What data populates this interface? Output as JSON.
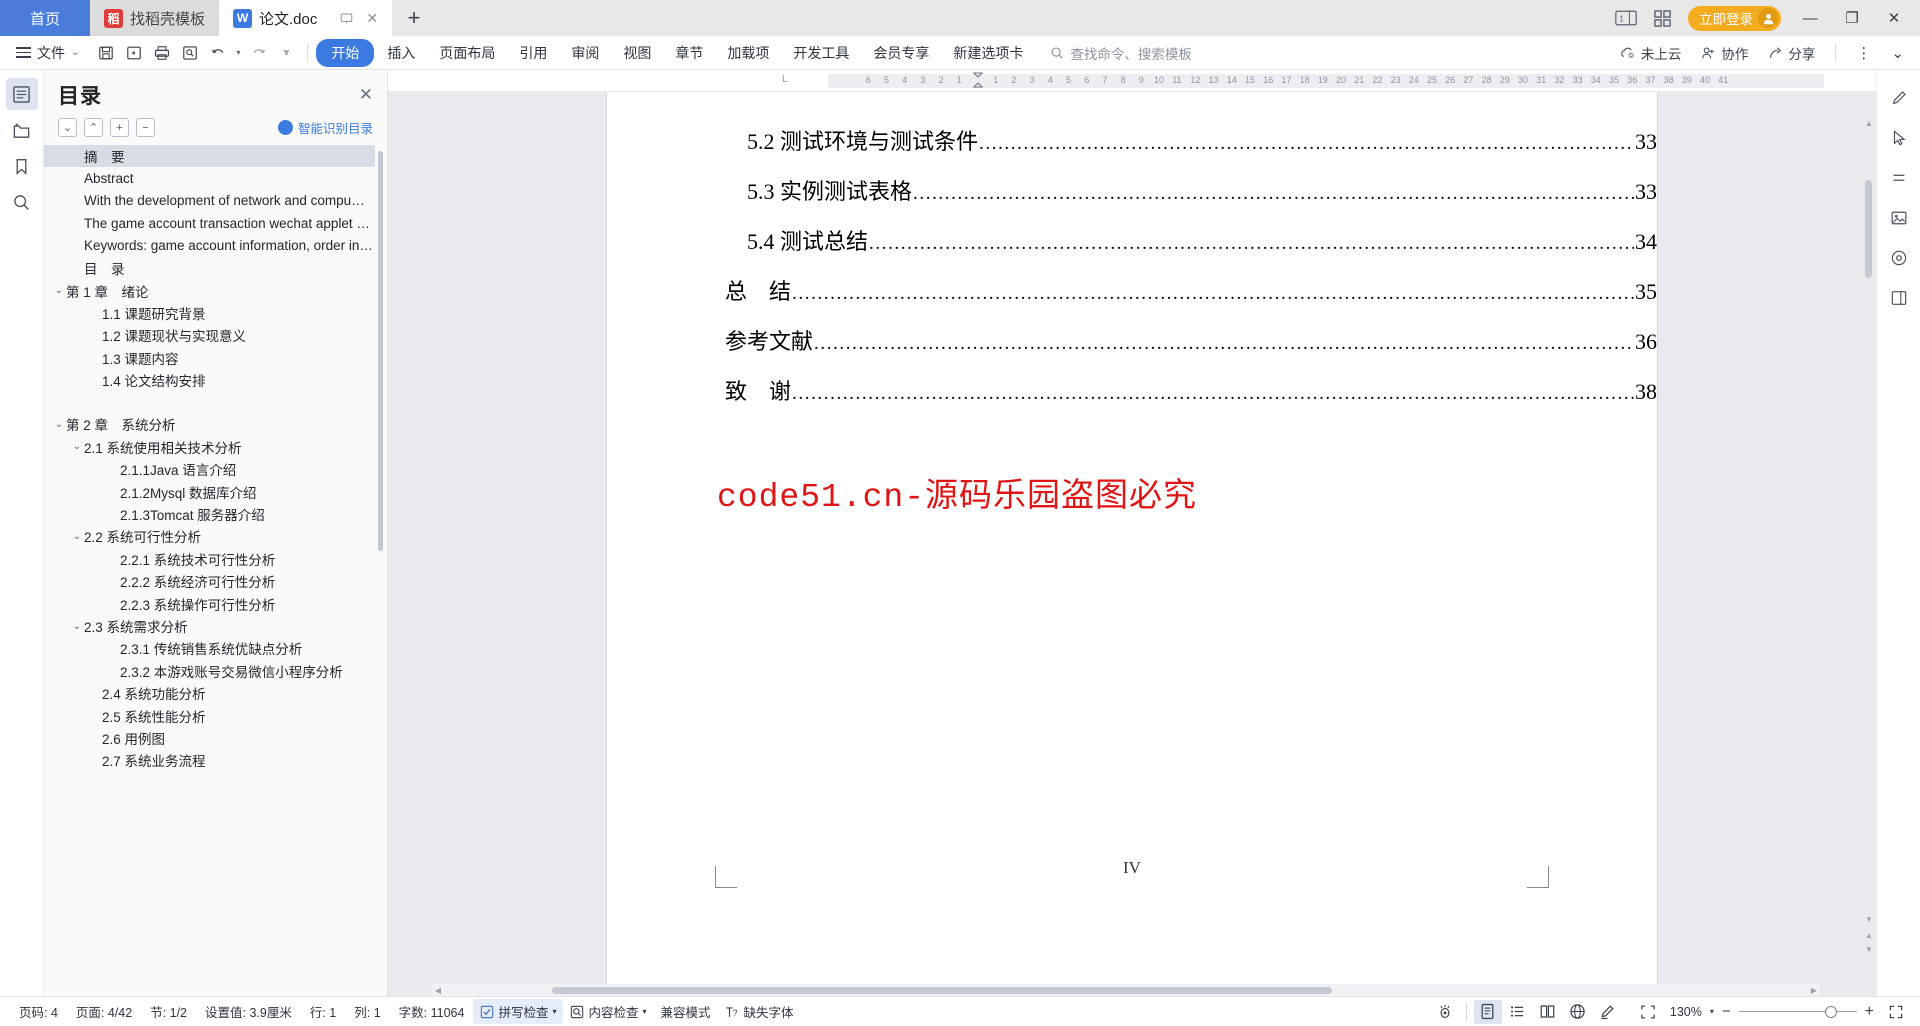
{
  "window": {
    "tabs": [
      {
        "label": "首页",
        "type": "home",
        "icon": null
      },
      {
        "label": "找稻壳模板",
        "type": "mid",
        "icon": "docer-icon"
      },
      {
        "label": "论文.doc",
        "type": "active",
        "icon": "wps-writer-icon"
      }
    ],
    "new_tab_label": "+",
    "controls": {
      "dual_screen_label": "1",
      "grid_label": "grid-icon",
      "login_label": "立即登录",
      "minimize": "—",
      "restore": "❐",
      "close": "✕"
    }
  },
  "ribbon": {
    "file_label": "文件",
    "quick_access": [
      "save-icon",
      "save-as-icon",
      "print-icon",
      "print-preview-icon",
      "undo-icon",
      "redo-icon",
      "customize-icon"
    ],
    "tabs": [
      {
        "label": "开始",
        "active": true
      },
      {
        "label": "插入",
        "active": false
      },
      {
        "label": "页面布局",
        "active": false
      },
      {
        "label": "引用",
        "active": false
      },
      {
        "label": "审阅",
        "active": false
      },
      {
        "label": "视图",
        "active": false
      },
      {
        "label": "章节",
        "active": false
      },
      {
        "label": "加载项",
        "active": false
      },
      {
        "label": "开发工具",
        "active": false
      },
      {
        "label": "会员专享",
        "active": false
      },
      {
        "label": "新建选项卡",
        "active": false
      }
    ],
    "search_placeholder": "查找命令、搜索模板",
    "right_items": [
      {
        "label": "未上云",
        "icon": "cloud-off-icon"
      },
      {
        "label": "协作",
        "icon": "collaborate-icon"
      },
      {
        "label": "分享",
        "icon": "share-icon"
      }
    ],
    "more_label": "⋮",
    "collapse_label": "⌄"
  },
  "left_rail": [
    {
      "name": "outline-icon",
      "active": true
    },
    {
      "name": "folder-icon",
      "active": false
    },
    {
      "name": "bookmark-icon",
      "active": false
    },
    {
      "name": "search-icon",
      "active": false
    }
  ],
  "outline": {
    "title": "目录",
    "close_label": "✕",
    "tools": [
      {
        "name": "expand-down-button",
        "glyph": "⌄"
      },
      {
        "name": "collapse-up-button",
        "glyph": "⌃"
      },
      {
        "name": "expand-all-button",
        "glyph": "+"
      },
      {
        "name": "collapse-all-button",
        "glyph": "−"
      }
    ],
    "smart_label": "智能识别目录",
    "items": [
      {
        "label": "摘　要",
        "indent": 1,
        "caret": "",
        "selected": true
      },
      {
        "label": "Abstract",
        "indent": 1,
        "caret": "",
        "selected": false
      },
      {
        "label": "With the development of network and compu…",
        "indent": 1,
        "caret": "",
        "selected": false
      },
      {
        "label": "The game account transaction wechat applet …",
        "indent": 1,
        "caret": "",
        "selected": false
      },
      {
        "label": "Keywords: game account information, order in…",
        "indent": 1,
        "caret": "",
        "selected": false
      },
      {
        "label": "目　录",
        "indent": 1,
        "caret": "",
        "selected": false
      },
      {
        "label": "第 1 章　绪论",
        "indent": 0,
        "caret": "⌄",
        "selected": false
      },
      {
        "label": "1.1 课题研究背景",
        "indent": 2,
        "caret": "",
        "selected": false
      },
      {
        "label": "1.2 课题现状与实现意义",
        "indent": 2,
        "caret": "",
        "selected": false
      },
      {
        "label": "1.3 课题内容",
        "indent": 2,
        "caret": "",
        "selected": false
      },
      {
        "label": "1.4 论文结构安排",
        "indent": 2,
        "caret": "",
        "selected": false
      },
      {
        "label": "",
        "indent": 0,
        "caret": "",
        "selected": false,
        "spacer": true
      },
      {
        "label": "第 2 章　系统分析",
        "indent": 0,
        "caret": "⌄",
        "selected": false
      },
      {
        "label": "2.1 系统使用相关技术分析",
        "indent": 1,
        "caret": "⌄",
        "selected": false
      },
      {
        "label": "2.1.1Java 语言介绍",
        "indent": 3,
        "caret": "",
        "selected": false
      },
      {
        "label": "2.1.2Mysql 数据库介绍",
        "indent": 3,
        "caret": "",
        "selected": false
      },
      {
        "label": "2.1.3Tomcat 服务器介绍",
        "indent": 3,
        "caret": "",
        "selected": false
      },
      {
        "label": "2.2 系统可行性分析",
        "indent": 1,
        "caret": "⌄",
        "selected": false
      },
      {
        "label": "2.2.1 系统技术可行性分析",
        "indent": 3,
        "caret": "",
        "selected": false
      },
      {
        "label": "2.2.2 系统经济可行性分析",
        "indent": 3,
        "caret": "",
        "selected": false
      },
      {
        "label": "2.2.3 系统操作可行性分析",
        "indent": 3,
        "caret": "",
        "selected": false
      },
      {
        "label": "2.3 系统需求分析",
        "indent": 1,
        "caret": "⌄",
        "selected": false
      },
      {
        "label": "2.3.1 传统销售系统优缺点分析",
        "indent": 3,
        "caret": "",
        "selected": false
      },
      {
        "label": "2.3.2 本游戏账号交易微信小程序分析",
        "indent": 3,
        "caret": "",
        "selected": false
      },
      {
        "label": "2.4 系统功能分析",
        "indent": 2,
        "caret": "",
        "selected": false
      },
      {
        "label": "2.5 系统性能分析",
        "indent": 2,
        "caret": "",
        "selected": false
      },
      {
        "label": "2.6 用例图",
        "indent": 2,
        "caret": "",
        "selected": false
      },
      {
        "label": "2.7 系统业务流程",
        "indent": 2,
        "caret": "",
        "selected": false
      }
    ]
  },
  "ruler": {
    "left_ticks": [
      "6",
      "5",
      "4",
      "3",
      "2",
      "1"
    ],
    "right_ticks": [
      "1",
      "2",
      "3",
      "4",
      "5",
      "6",
      "7",
      "8",
      "9",
      "10",
      "11",
      "12",
      "13",
      "14",
      "15",
      "16",
      "17",
      "18",
      "19",
      "20",
      "21",
      "22",
      "23",
      "24",
      "25",
      "26",
      "27",
      "28",
      "29",
      "30",
      "31",
      "32",
      "33",
      "34",
      "35",
      "36",
      "37",
      "38",
      "39",
      "40",
      "41"
    ],
    "corner_label": "L"
  },
  "document": {
    "toc_entries": [
      {
        "label": "5.2 测试环境与测试条件",
        "page": "33",
        "level": 2
      },
      {
        "label": "5.3 实例测试表格",
        "page": "33",
        "level": 2
      },
      {
        "label": "5.4 测试总结",
        "page": "34",
        "level": 2
      },
      {
        "label": "总　结",
        "page": "35",
        "level": 1
      },
      {
        "label": "参考文献",
        "page": "36",
        "level": 1
      },
      {
        "label": "致　谢",
        "page": "38",
        "level": 1
      }
    ],
    "watermark": "code51.cn-源码乐园盗图必究",
    "watermark_color": "#e01414",
    "page_number_label": "IV"
  },
  "right_rail": [
    {
      "name": "edit-pen-icon"
    },
    {
      "name": "cursor-select-icon"
    },
    {
      "name": "paragraph-mark-icon"
    },
    {
      "name": "image-insert-icon"
    },
    {
      "name": "shape-insert-icon"
    },
    {
      "name": "page-layout-icon"
    }
  ],
  "status": {
    "left_items": [
      {
        "label": "页码: 4",
        "name": "page-code"
      },
      {
        "label": "页面: 4/42",
        "name": "page-count"
      },
      {
        "label": "节: 1/2",
        "name": "section"
      },
      {
        "label": "设置值: 3.9厘米",
        "name": "setting-value"
      },
      {
        "label": "行: 1",
        "name": "row"
      },
      {
        "label": "列: 1",
        "name": "column"
      },
      {
        "label": "字数: 11064",
        "name": "word-count"
      }
    ],
    "buttons": [
      {
        "label": "拼写检查",
        "icon": "spellcheck-icon",
        "caret": "▾",
        "highlight": true
      },
      {
        "label": "内容检查",
        "icon": "content-check-icon",
        "caret": "▾",
        "highlight": false
      },
      {
        "label": "兼容模式",
        "icon": "",
        "caret": "",
        "highlight": false
      },
      {
        "label": "缺失字体",
        "icon": "missing-font-icon",
        "caret": "",
        "highlight": false
      }
    ],
    "view_buttons": [
      {
        "name": "eye-icon",
        "active": false
      },
      {
        "name": "page-view-icon",
        "active": true
      },
      {
        "name": "outline-view-icon",
        "active": false
      },
      {
        "name": "read-view-icon",
        "active": false
      },
      {
        "name": "web-view-icon",
        "active": false
      },
      {
        "name": "highlight-pen-icon",
        "active": false
      }
    ],
    "fit_icon": "fit-page-icon",
    "zoom_label": "130%",
    "zoom_caret": "▾",
    "zoom_minus": "−",
    "zoom_plus": "+",
    "fullscreen_icon": "fullscreen-icon"
  }
}
